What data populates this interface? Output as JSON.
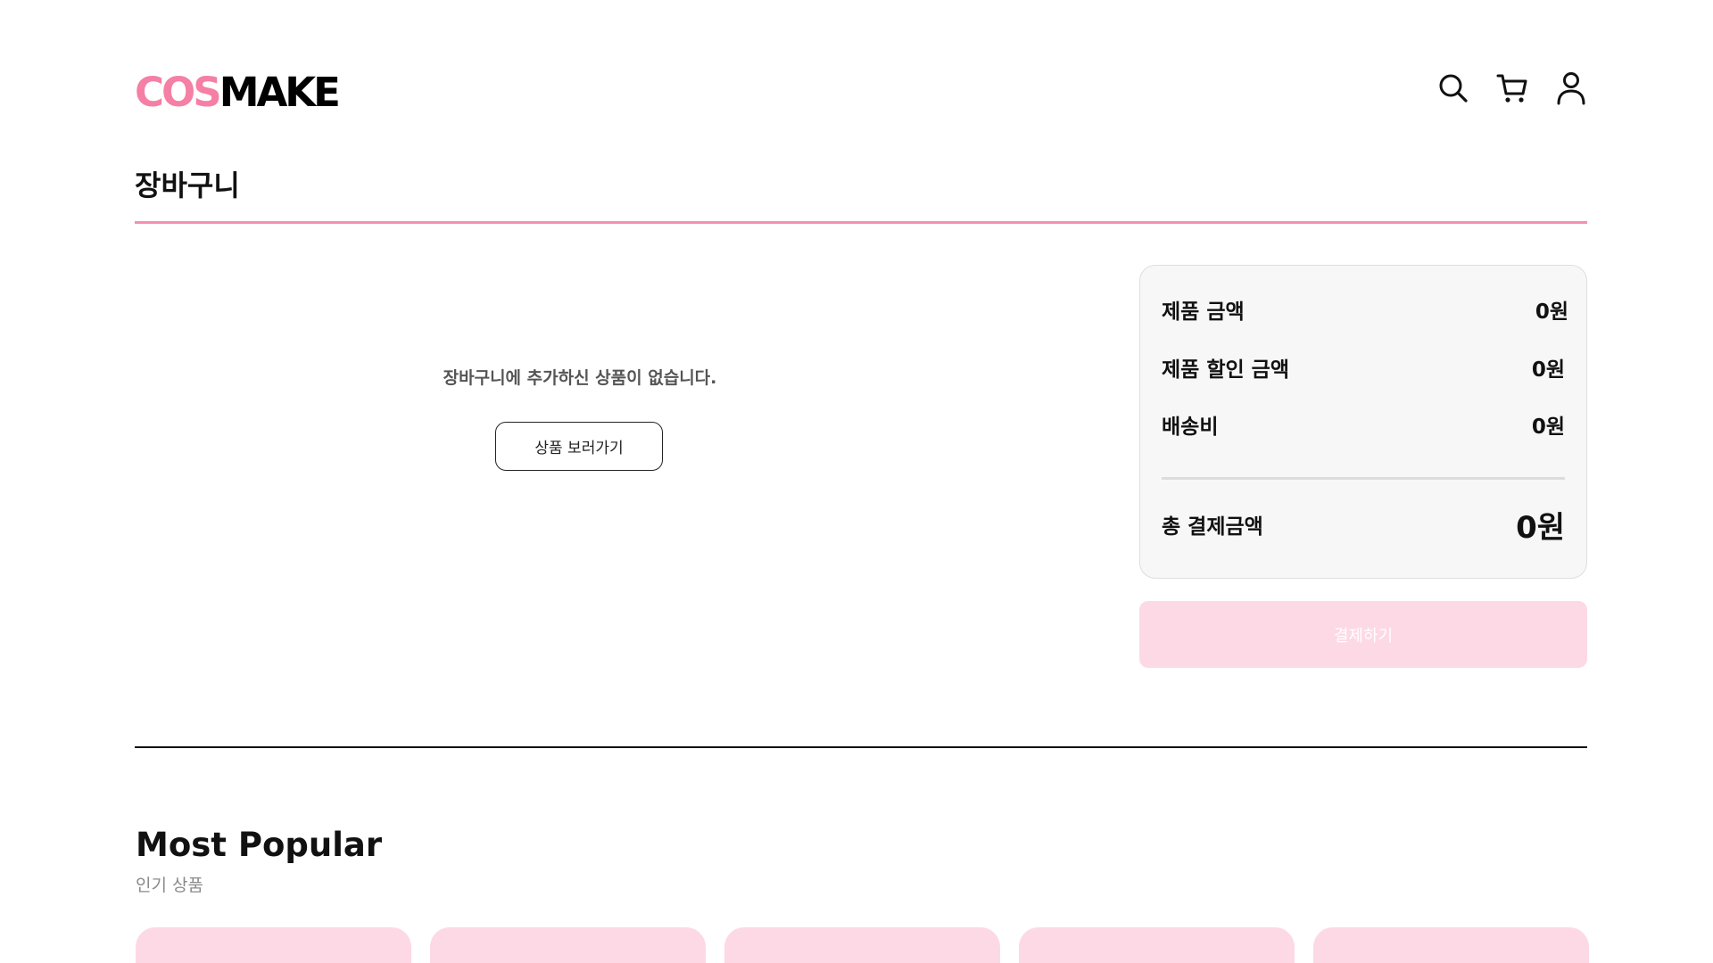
{
  "header": {
    "logo": {
      "part1": "COS",
      "part2": "MAKE"
    },
    "icons": [
      "search-icon",
      "cart-icon",
      "user-icon"
    ]
  },
  "page": {
    "title": "장바구니"
  },
  "cart": {
    "empty_message": "장바구니에 추가하신 상품이 없습니다.",
    "browse_button": "상품 보러가기"
  },
  "summary": {
    "rows": [
      {
        "label": "제품 금액",
        "value": "0원"
      },
      {
        "label": "제품 할인 금액",
        "value": "0원"
      },
      {
        "label": "배송비",
        "value": "0원"
      }
    ],
    "total_label": "총 결제금액",
    "total_value": "0원",
    "checkout_button": "결제하기"
  },
  "popular": {
    "title": "Most Popular",
    "subtitle": "인기 상품",
    "card_count": 5
  },
  "colors": {
    "brand_pink": "#f57fa5",
    "accent_rule": "#f58fb0",
    "card_pink": "#fdd9e5",
    "summary_bg": "#f7f7f7"
  }
}
